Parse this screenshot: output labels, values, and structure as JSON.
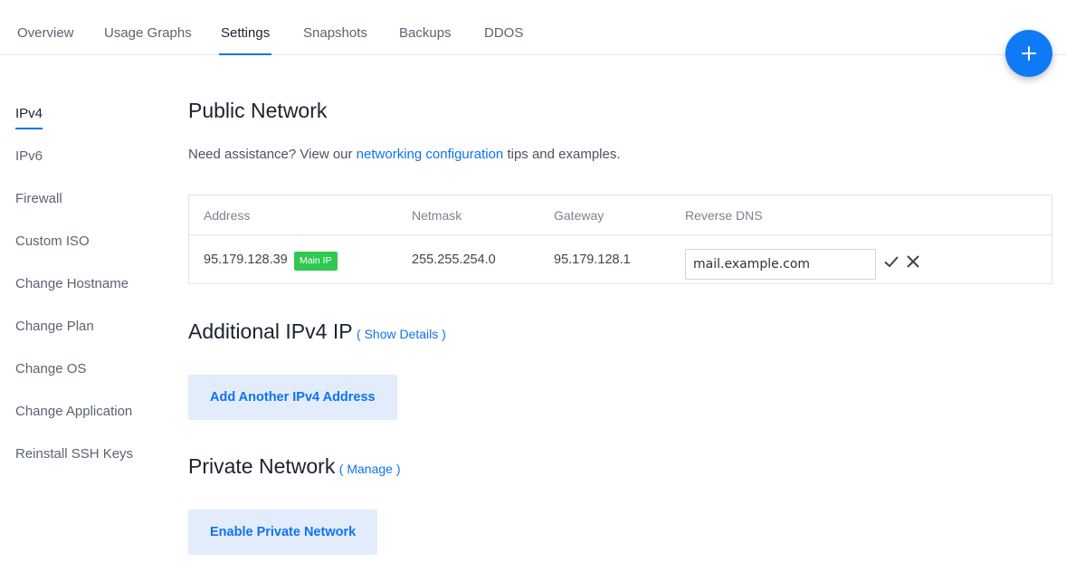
{
  "tabs": [
    {
      "label": "Overview",
      "active": false
    },
    {
      "label": "Usage Graphs",
      "active": false
    },
    {
      "label": "Settings",
      "active": true
    },
    {
      "label": "Snapshots",
      "active": false
    },
    {
      "label": "Backups",
      "active": false
    },
    {
      "label": "DDOS",
      "active": false
    }
  ],
  "fab": {
    "icon": "plus-icon"
  },
  "sidebar": {
    "items": [
      {
        "label": "IPv4",
        "active": true
      },
      {
        "label": "IPv6"
      },
      {
        "label": "Firewall"
      },
      {
        "label": "Custom ISO"
      },
      {
        "label": "Change Hostname"
      },
      {
        "label": "Change Plan"
      },
      {
        "label": "Change OS"
      },
      {
        "label": "Change Application"
      },
      {
        "label": "Reinstall SSH Keys"
      }
    ]
  },
  "public_network": {
    "title": "Public Network",
    "help_prefix": "Need assistance? View our ",
    "help_link": "networking configuration",
    "help_suffix": " tips and examples.",
    "table": {
      "headers": [
        "Address",
        "Netmask",
        "Gateway",
        "Reverse DNS"
      ],
      "row": {
        "address": "95.179.128.39",
        "badge": "Main IP",
        "netmask": "255.255.254.0",
        "gateway": "95.179.128.1",
        "reverse_dns": "mail.example.com"
      }
    }
  },
  "additional": {
    "title": "Additional IPv4 IP",
    "link": "( Show Details )",
    "button": "Add Another IPv4 Address"
  },
  "private_network": {
    "title": "Private Network",
    "link": "( Manage )",
    "button": "Enable Private Network"
  },
  "colors": {
    "accent": "#0d74f3",
    "badge": "#2ec94e",
    "button_bg": "#e3ecfb"
  }
}
